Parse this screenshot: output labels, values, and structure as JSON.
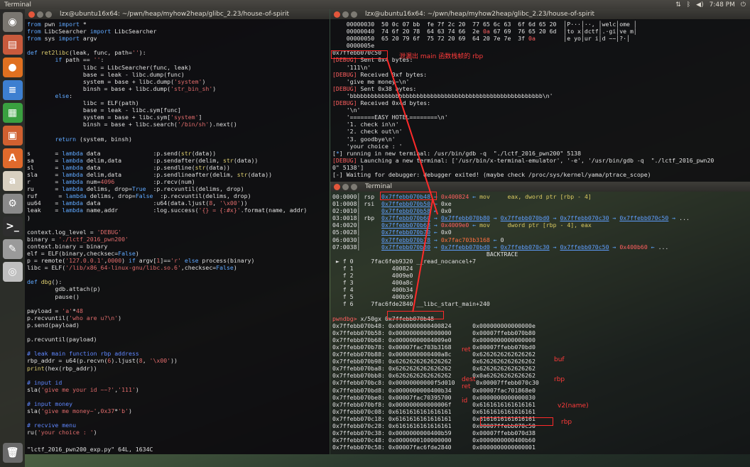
{
  "panel": {
    "app_name": "Terminal",
    "time": "7:48 PM"
  },
  "launcher": {
    "items": [
      {
        "name": "dash-icon",
        "glyph": "◉",
        "bg": "#7a7670"
      },
      {
        "name": "files-icon",
        "glyph": "▤",
        "bg": "#c85a3c"
      },
      {
        "name": "firefox-icon",
        "glyph": "●",
        "bg": "#e07020"
      },
      {
        "name": "writer-icon",
        "glyph": "≡",
        "bg": "#3d7fd0"
      },
      {
        "name": "calc-icon",
        "glyph": "▦",
        "bg": "#3aa040"
      },
      {
        "name": "impress-icon",
        "glyph": "▣",
        "bg": "#d06030"
      },
      {
        "name": "software-icon",
        "glyph": "A",
        "bg": "#e06a2c"
      },
      {
        "name": "amazon-icon",
        "glyph": "a",
        "bg": "#d8d0c0"
      },
      {
        "name": "settings-icon",
        "glyph": "⚙",
        "bg": "#8a8a8a"
      },
      {
        "name": "terminal-icon",
        "glyph": ">_",
        "bg": "#2e2e2e"
      },
      {
        "name": "editor-icon",
        "glyph": "✎",
        "bg": "#9a9a9a"
      },
      {
        "name": "dvd-icon",
        "glyph": "◎",
        "bg": "#bfbfbf"
      }
    ]
  },
  "left_window": {
    "title": "lzx@ubuntu16x64: ~/pwn/heap/myhow2heap/glibc_2.23/house-of-spirit",
    "status": "\"lctf_2016_pwn200_exp.py\" 64L, 1634C"
  },
  "right_window": {
    "title": "lzx@ubuntu16x64: ~/pwn/heap/myhow2heap/glibc_2.23/house-of-spirit"
  },
  "gdb_window": {
    "title": "Terminal"
  },
  "annotations": {
    "leak_note": "泄漏出 main 函数栈帧的 rbp",
    "ret1": "ret",
    "buf": "buf",
    "rbp1": "rbp",
    "dest": "dest",
    "ret2": "ret",
    "id": "id",
    "v2": "v2(name)",
    "rbp2": "rbp"
  }
}
